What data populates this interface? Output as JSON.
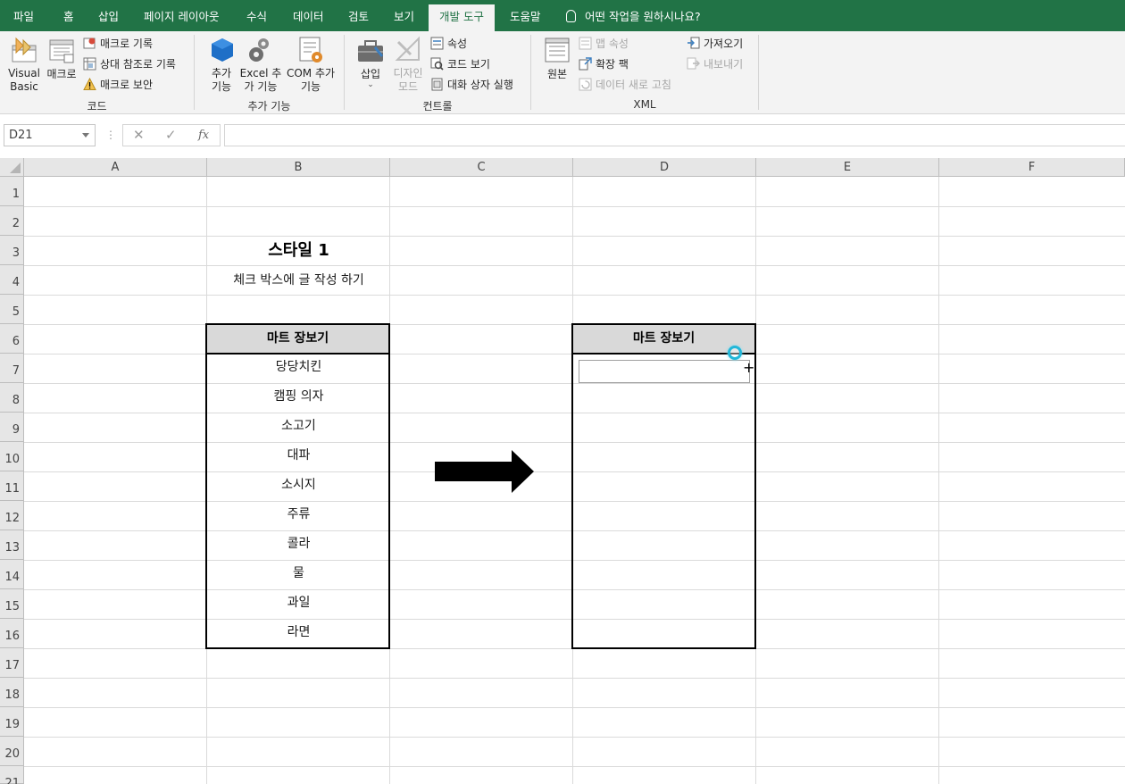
{
  "menu": {
    "tabs": [
      "파일",
      "홈",
      "삽입",
      "페이지 레이아웃",
      "수식",
      "데이터",
      "검토",
      "보기",
      "개발 도구",
      "도움말"
    ],
    "active_tab": "개발 도구",
    "tell_me": "어떤 작업을 원하시나요?"
  },
  "ribbon": {
    "code": {
      "visual_basic": "Visual Basic",
      "macro": "매크로",
      "record_macro": "매크로 기록",
      "relative_ref": "상대 참조로 기록",
      "macro_security": "매크로 보안",
      "label": "코드"
    },
    "addins": {
      "addins": "추가 기능",
      "excel_addins": "Excel 추가 기능",
      "com_addins": "COM 추가 기능",
      "label": "추가 기능"
    },
    "controls": {
      "insert": "삽입",
      "design_mode": "디자인 모드",
      "properties": "속성",
      "view_code": "코드 보기",
      "run_dialog": "대화 상자 실행",
      "label": "컨트롤"
    },
    "xml": {
      "source": "원본",
      "map_properties": "맵 속성",
      "expansion_packs": "확장 팩",
      "refresh_data": "데이터 새로 고침",
      "import": "가져오기",
      "export": "내보내기",
      "label": "XML"
    }
  },
  "formula_bar": {
    "name_box": "D21",
    "dots": "⋮",
    "cancel": "✕",
    "enter": "✓",
    "fx": "fx",
    "formula": ""
  },
  "sheet": {
    "columns": [
      "A",
      "B",
      "C",
      "D",
      "E",
      "F"
    ],
    "rows": [
      "1",
      "2",
      "3",
      "4",
      "5",
      "6",
      "7",
      "8",
      "9",
      "10",
      "11",
      "12",
      "13",
      "14",
      "15",
      "16",
      "17",
      "18",
      "19",
      "20",
      "21"
    ],
    "title": "스타일 1",
    "subtitle": "체크 박스에 글 작성 하기",
    "left_table": {
      "header": "마트 장보기",
      "items": [
        "당당치킨",
        "캠핑 의자",
        "소고기",
        "대파",
        "소시지",
        "주류",
        "콜라",
        "물",
        "과일",
        "라면"
      ]
    },
    "right_table": {
      "header": "마트 장보기"
    },
    "arrow_color": "#000000"
  },
  "colors": {
    "accent": "#217346",
    "ribbon_bg": "#f3f3f3",
    "header_fill": "#d9d9d9",
    "handle": "#22b7d9"
  }
}
